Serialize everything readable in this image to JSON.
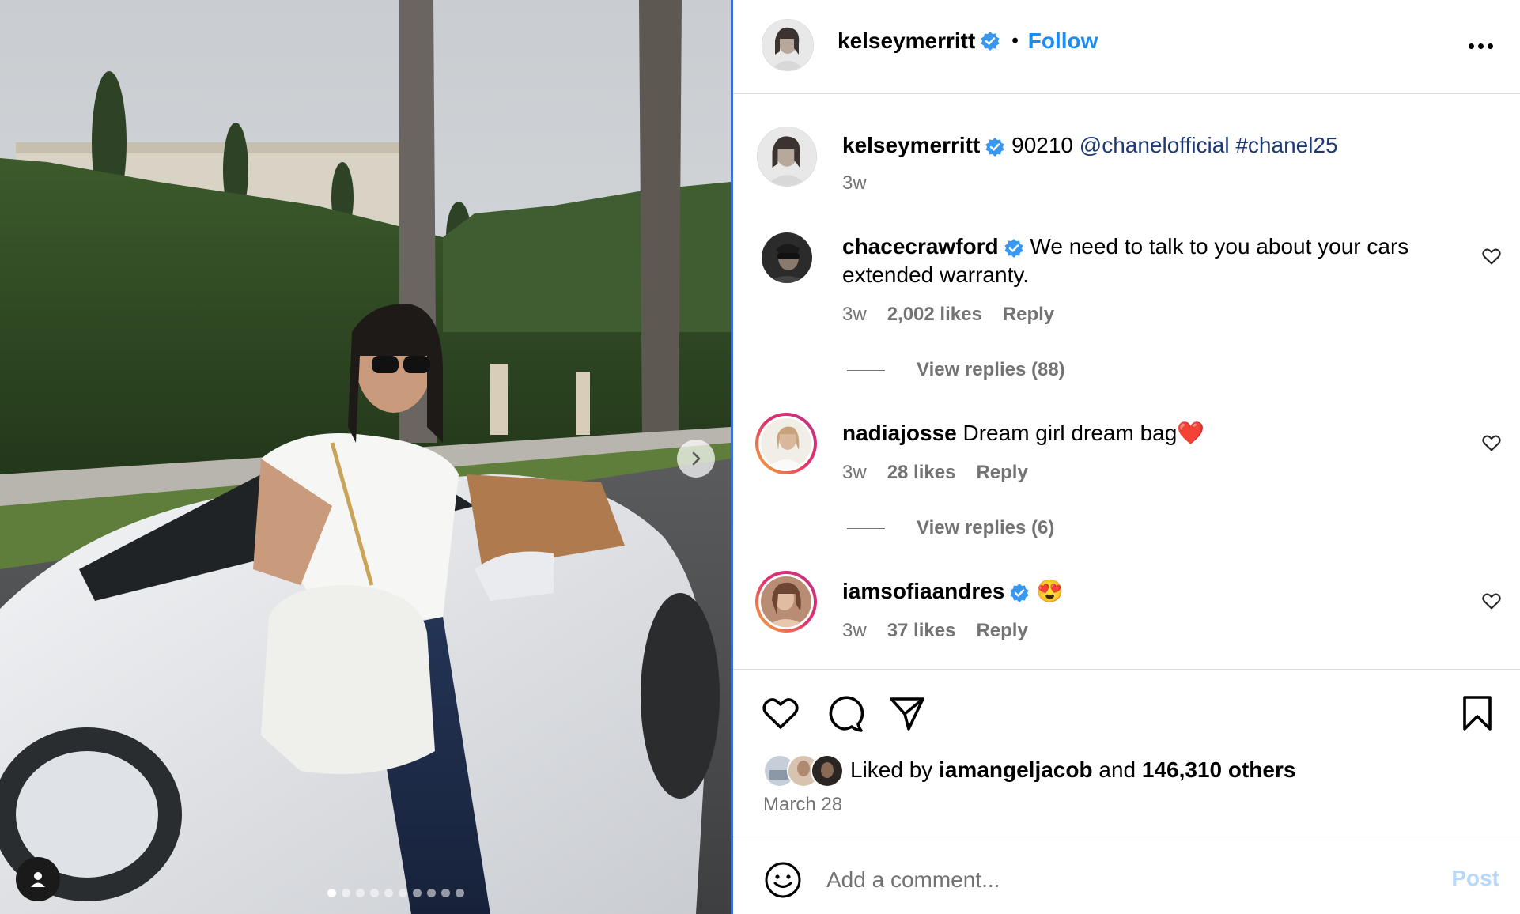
{
  "photo": {
    "alt_icons": {
      "next": "chevron-right-icon",
      "user_tag": "person-icon"
    },
    "carousel": {
      "count": 10,
      "active_index": 0
    }
  },
  "header": {
    "username": "kelseymerritt",
    "separator": "•",
    "follow_label": "Follow"
  },
  "caption": {
    "username": "kelseymerritt",
    "text_plain": "90210",
    "mention": "@chanelofficial",
    "hashtag": "#chanel25",
    "time": "3w"
  },
  "comments": [
    {
      "username": "chacecrawford",
      "verified": true,
      "text": "We need to talk to you about your cars extended warranty.",
      "time": "3w",
      "likes": "2,002 likes",
      "reply_label": "Reply",
      "view_replies": "View replies (88)"
    },
    {
      "username": "nadiajosse",
      "verified": false,
      "text": "Dream girl dream bag❤️",
      "time": "3w",
      "likes": "28 likes",
      "reply_label": "Reply",
      "view_replies": "View replies (6)"
    },
    {
      "username": "iamsofiaandres",
      "verified": true,
      "text": "😍",
      "time": "3w",
      "likes": "37 likes",
      "reply_label": "Reply"
    }
  ],
  "actions": {
    "like_icon": "heart-icon",
    "comment_icon": "comment-icon",
    "share_icon": "paper-plane-icon",
    "save_icon": "bookmark-icon"
  },
  "likes": {
    "prefix": "Liked by",
    "user": "iamangeljacob",
    "and": "and",
    "others": "146,310 others"
  },
  "post_date": "March 28",
  "comment_box": {
    "placeholder": "Add a comment...",
    "post_label": "Post"
  },
  "colors": {
    "link_blue": "#1d8cf0",
    "verified_blue": "#3897f0",
    "muted_gray": "#737373",
    "post_disabled": "#b7d8fb",
    "story_ring_start": "#f9b233",
    "story_ring_end": "#c13584"
  }
}
